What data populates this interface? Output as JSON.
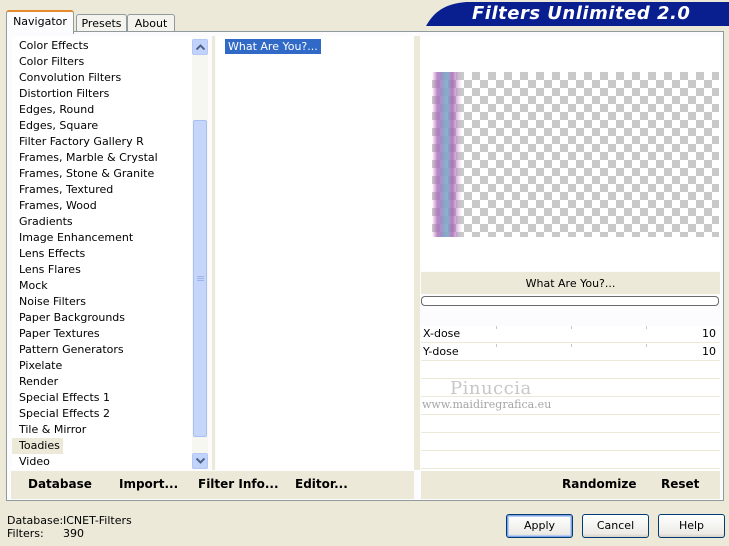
{
  "tabs": [
    {
      "label": "Navigator",
      "active": true
    },
    {
      "label": "Presets",
      "active": false
    },
    {
      "label": "About",
      "active": false
    }
  ],
  "app_title": "Filters Unlimited 2.0",
  "categories": [
    "Color Effects",
    "Color Filters",
    "Convolution Filters",
    "Distortion Filters",
    "Edges, Round",
    "Edges, Square",
    "Filter Factory Gallery R",
    "Frames, Marble & Crystal",
    "Frames, Stone & Granite",
    "Frames, Textured",
    "Frames, Wood",
    "Gradients",
    "Image Enhancement",
    "Lens Effects",
    "Lens Flares",
    "Mock",
    "Noise Filters",
    "Paper Backgrounds",
    "Paper Textures",
    "Pattern Generators",
    "Pixelate",
    "Render",
    "Special Effects 1",
    "Special Effects 2",
    "Tile & Mirror",
    "Toadies",
    "Video"
  ],
  "selected_category": "Toadies",
  "filters": [
    "What Are You?..."
  ],
  "selected_filter_name": "What Are You?...",
  "params": [
    {
      "label": "X-dose",
      "value": "10"
    },
    {
      "label": "Y-dose",
      "value": "10"
    }
  ],
  "watermark": {
    "line1": "Pinuccia",
    "line2": "www.maidiregrafica.eu"
  },
  "toolbar": {
    "database": "Database",
    "import": "Import...",
    "filter_info": "Filter Info...",
    "editor": "Editor...",
    "randomize": "Randomize",
    "reset": "Reset"
  },
  "status": {
    "database_label": "Database:",
    "database_value": "ICNET-Filters",
    "filters_label": "Filters:",
    "filters_value": "390"
  },
  "buttons": {
    "apply": "Apply",
    "cancel": "Cancel",
    "help": "Help"
  },
  "colors": {
    "accent": "#3169c6",
    "banner": "#0a1f8f",
    "tab_highlight": "#e68b2c"
  }
}
